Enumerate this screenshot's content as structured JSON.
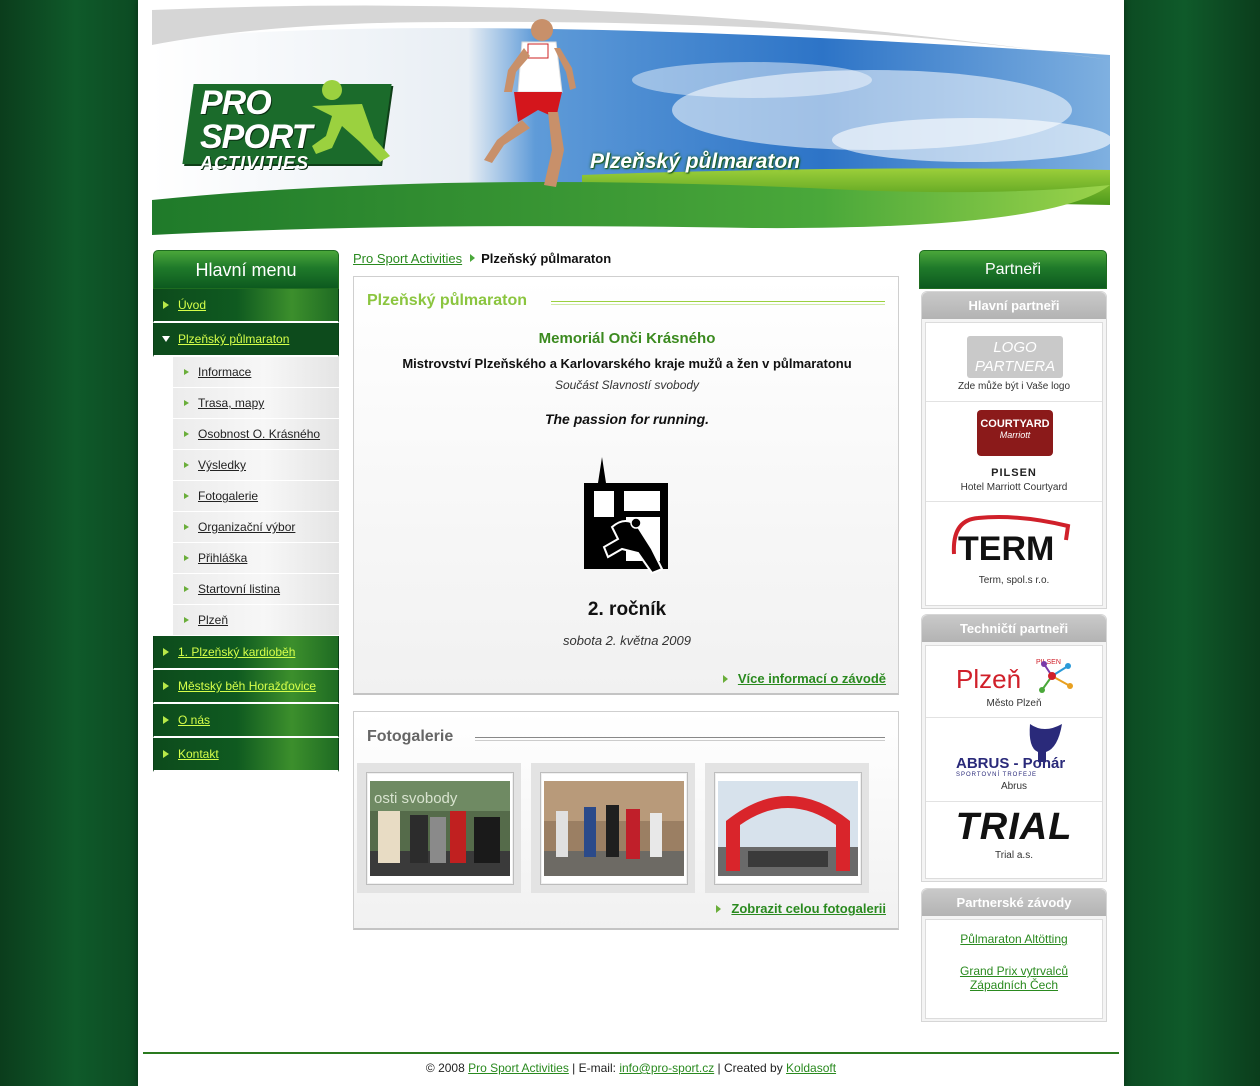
{
  "header": {
    "logo": {
      "line1": "PRO",
      "line2": "SPORT",
      "line3": "ACTIVITIES"
    },
    "title": "Plzeňský půlmaraton",
    "runner_bib": "357"
  },
  "left_menu": {
    "title": "Hlavní menu",
    "items": [
      {
        "label": "Úvod"
      },
      {
        "label": "Plzeňský půlmaraton",
        "open": true
      }
    ],
    "sub_items": [
      {
        "label": "Informace"
      },
      {
        "label": "Trasa, mapy"
      },
      {
        "label": "Osobnost O. Krásného"
      },
      {
        "label": "Výsledky"
      },
      {
        "label": "Fotogalerie"
      },
      {
        "label": "Organizační výbor"
      },
      {
        "label": "Přihláška"
      },
      {
        "label": "Startovní listina"
      },
      {
        "label": "Plzeň"
      }
    ],
    "bottom_items": [
      {
        "label": "1. Plzeňský kardioběh"
      },
      {
        "label": "Městský běh Horažďovice"
      },
      {
        "label": "O nás"
      },
      {
        "label": "Kontakt"
      }
    ]
  },
  "breadcrumb": {
    "home": "Pro Sport Activities",
    "current": "Plzeňský půlmaraton"
  },
  "main": {
    "title": "Plzeňský půlmaraton",
    "memorial": "Memoriál Onči Krásného",
    "championship": "Mistrovství Plzeňského a Karlovarského kraje mužů a žen v půlmaratonu",
    "part_of": "Součást Slavností svobody",
    "slogan": "The passion for running.",
    "edition": "2. ročník",
    "date": "sobota 2. května 2009",
    "more_link": "Více informací o závodě"
  },
  "gallery": {
    "title": "Fotogalerie",
    "photo1_banner": "osti svobody",
    "show_all_link": "Zobrazit celou fotogalerii"
  },
  "right": {
    "title": "Partneři",
    "main_partners": {
      "title": "Hlavní partneři",
      "logo_placeholder_l1": "LOGO",
      "logo_placeholder_l2": "PARTNERA",
      "logo_caption": "Zde může být i Vaše logo",
      "courtyard_name": "COURTYARD",
      "courtyard_brand": "Marriott",
      "courtyard_city": "PILSEN",
      "courtyard_caption": "Hotel Marriott Courtyard",
      "term_logo": "TERM",
      "term_caption": "Term, spol.s r.o."
    },
    "tech_partners": {
      "title": "Techničtí partneři",
      "plzen_logo": "Plzeň",
      "plzen_small": "PILSEN",
      "plzen_caption": "Město Plzeň",
      "abrus_logo": "ABRUS - Pohár",
      "abrus_sub": "SPORTOVNÍ TROFEJE",
      "abrus_caption": "Abrus",
      "trial_logo": "TRIAL",
      "trial_caption": "Trial a.s."
    },
    "partner_races": {
      "title": "Partnerské závody",
      "link1": "Půlmaraton Altötting",
      "link2_l1": "Grand Prix vytrvalců",
      "link2_l2": "Západních Čech"
    }
  },
  "footer": {
    "copyright": "© 2008",
    "company": "Pro Sport Activities",
    "email_label": " | E-mail: ",
    "email": "info@pro-sport.cz",
    "created_label": " | Created by ",
    "creator": "Koldasoft"
  }
}
